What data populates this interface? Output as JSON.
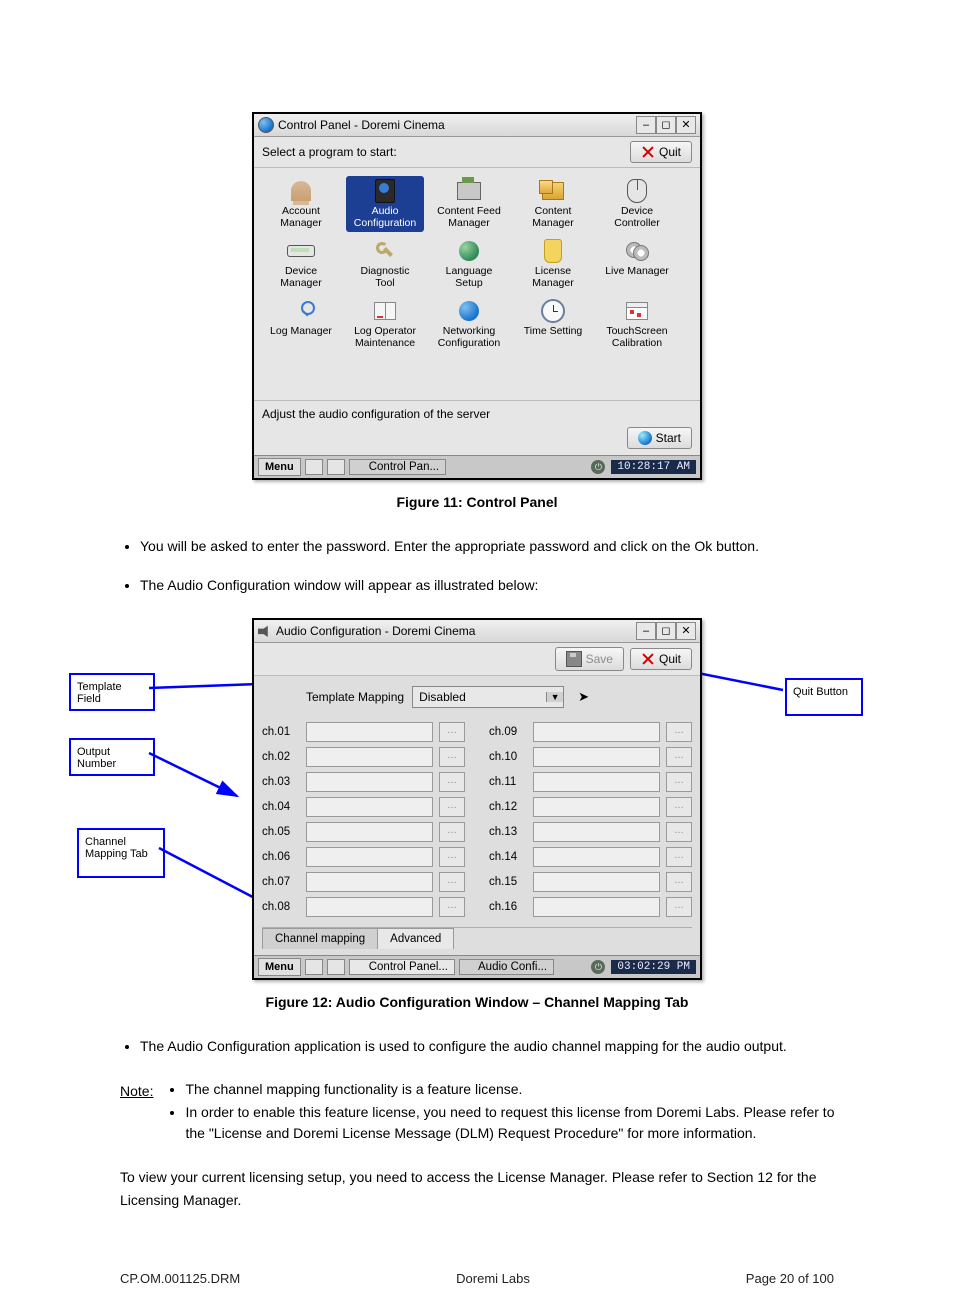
{
  "figure11": {
    "window_title": "Control Panel - Doremi Cinema",
    "subbar_text": "Select a program to start:",
    "quit_label": "Quit",
    "apps": [
      {
        "key": "account-manager",
        "label": "Account\nManager",
        "glyph": "g-person"
      },
      {
        "key": "audio-configuration",
        "label": "Audio\nConfiguration",
        "glyph": "g-speaker",
        "selected": true
      },
      {
        "key": "content-feed-manager",
        "label": "Content Feed\nManager",
        "glyph": "g-printer"
      },
      {
        "key": "content-manager",
        "label": "Content\nManager",
        "glyph": "g-box"
      },
      {
        "key": "device-controller",
        "label": "Device\nController",
        "glyph": "g-mouse"
      },
      {
        "key": "device-manager",
        "label": "Device\nManager",
        "glyph": "g-scanner"
      },
      {
        "key": "diagnostic-tool",
        "label": "Diagnostic\nTool",
        "glyph": "g-wrench"
      },
      {
        "key": "language-setup",
        "label": "Language\nSetup",
        "glyph": "g-globe2"
      },
      {
        "key": "license-manager",
        "label": "License\nManager",
        "glyph": "g-tag"
      },
      {
        "key": "live-manager",
        "label": "Live Manager",
        "glyph": "g-disks"
      },
      {
        "key": "log-manager",
        "label": "Log Manager",
        "glyph": "g-search"
      },
      {
        "key": "log-operator-maintenance",
        "label": "Log Operator\nMaintenance",
        "glyph": "g-book"
      },
      {
        "key": "networking-configuration",
        "label": "Networking\nConfiguration",
        "glyph": "g-globe"
      },
      {
        "key": "time-setting",
        "label": "Time Setting",
        "glyph": "g-clock"
      },
      {
        "key": "touchscreen-calibration",
        "label": "TouchScreen\nCalibration",
        "glyph": "g-cal"
      }
    ],
    "status_text": "Adjust the audio configuration of the server",
    "start_label": "Start",
    "taskbar": {
      "menu": "Menu",
      "task": "Control Pan...",
      "clock": "10:28:17 AM"
    },
    "caption": "Figure 11: Control Panel"
  },
  "text_after_fig11": [
    "You will be asked to enter the password. Enter the appropriate password and click on the Ok button.",
    "The Audio Configuration window will appear as illustrated below:"
  ],
  "figure12": {
    "window_title": "Audio Configuration - Doremi Cinema",
    "save_label": "Save",
    "quit_label": "Quit",
    "template_label": "Template Mapping",
    "template_value": "Disabled",
    "channels_left": [
      "ch.01",
      "ch.02",
      "ch.03",
      "ch.04",
      "ch.05",
      "ch.06",
      "ch.07",
      "ch.08"
    ],
    "channels_right": [
      "ch.09",
      "ch.10",
      "ch.11",
      "ch.12",
      "ch.13",
      "ch.14",
      "ch.15",
      "ch.16"
    ],
    "more": "…",
    "tabs": [
      "Channel mapping",
      "Advanced"
    ],
    "taskbar": {
      "menu": "Menu",
      "task1": "Control Panel...",
      "task2": "Audio Confi...",
      "clock": "03:02:29 PM"
    },
    "caption": "Figure 12: Audio Configuration Window – Channel Mapping Tab",
    "callouts": {
      "template_field": "Template Field",
      "output_number": "Output Number",
      "channel_mapping": "Channel Mapping Tab",
      "quit": "Quit Button"
    }
  },
  "text_after_fig12": [
    "The Audio Configuration application is used to configure the audio channel mapping for the audio output."
  ],
  "note": {
    "label": "Note:",
    "items": [
      "The channel mapping functionality is a feature license.",
      "In order to enable this feature license, you need to request this license from Doremi Labs. Please refer to the \"License and Doremi License Message (DLM) Request Procedure\" for more information."
    ]
  },
  "closing_text": "To view your current licensing setup, you need to access the License Manager. Please refer to Section 12 for the Licensing Manager.",
  "footer": {
    "left": "CP.OM.001125.DRM",
    "center": "Doremi Labs",
    "right": "Page 20 of 100"
  }
}
